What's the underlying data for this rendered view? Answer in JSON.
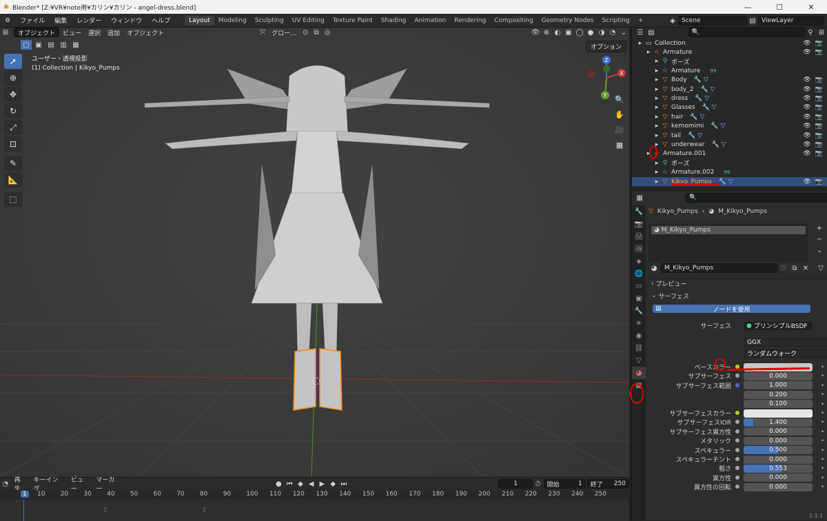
{
  "titlebar": {
    "title": "Blender* [Z:¥VR¥note用¥カリン¥カリン - angel-dress.blend]",
    "minimize": "—",
    "maximize": "☐",
    "close": "✕"
  },
  "menubar": {
    "items": [
      "ファイル",
      "編集",
      "レンダー",
      "ウィンドウ",
      "ヘルプ"
    ],
    "workspaces": [
      "Layout",
      "Modeling",
      "Sculpting",
      "UV Editing",
      "Texture Paint",
      "Shading",
      "Animation",
      "Rendering",
      "Compositing",
      "Geometry Nodes",
      "Scripting"
    ],
    "add_ws": "+",
    "scene": "Scene",
    "view_layer": "ViewLayer"
  },
  "viewport": {
    "mode": "オブジェクト",
    "menus": [
      "ビュー",
      "選択",
      "追加",
      "オブジェクト"
    ],
    "transform": "グロー…",
    "info_line1": "ユーザー・透視投影",
    "info_line2": "(1) Collection | Kikyo_Pumps",
    "option": "オプション",
    "gizmo": {
      "x": "X",
      "y": "Y",
      "z": "Z"
    }
  },
  "timeline": {
    "menus": [
      "再生",
      "キーイング",
      "ビュー",
      "マーカー"
    ],
    "current_frame": "1",
    "start_label": "開始",
    "start": "1",
    "end_label": "終了",
    "end": "250",
    "ticks": [
      "1",
      "10",
      "20",
      "30",
      "40",
      "50",
      "60",
      "70",
      "80",
      "90",
      "100",
      "110",
      "120",
      "130",
      "140",
      "150",
      "160",
      "170",
      "180",
      "190",
      "200",
      "210",
      "220",
      "230",
      "240",
      "250"
    ]
  },
  "outliner": {
    "search_placeholder": "",
    "rows": [
      {
        "label": "Collection",
        "depth": 0,
        "icon": "collection-icon"
      },
      {
        "label": "Armature",
        "depth": 1,
        "icon": "armature-icon"
      },
      {
        "label": "ポーズ",
        "depth": 2,
        "icon": "pose-icon"
      },
      {
        "label": "Armature",
        "depth": 2,
        "icon": "armature-data-icon",
        "badge": "99"
      },
      {
        "label": "Body",
        "depth": 2,
        "icon": "mesh-icon"
      },
      {
        "label": "body_2",
        "depth": 2,
        "icon": "mesh-icon"
      },
      {
        "label": "dress",
        "depth": 2,
        "icon": "mesh-icon"
      },
      {
        "label": "Glasses",
        "depth": 2,
        "icon": "mesh-icon"
      },
      {
        "label": "hair",
        "depth": 2,
        "icon": "mesh-icon"
      },
      {
        "label": "kemomimi",
        "depth": 2,
        "icon": "mesh-icon"
      },
      {
        "label": "tail",
        "depth": 2,
        "icon": "mesh-icon"
      },
      {
        "label": "underwear",
        "depth": 2,
        "icon": "mesh-icon"
      },
      {
        "label": "Armature.001",
        "depth": 1,
        "icon": "armature-icon"
      },
      {
        "label": "ポーズ",
        "depth": 2,
        "icon": "pose-icon"
      },
      {
        "label": "Armature.002",
        "depth": 2,
        "icon": "armature-data-icon",
        "badge": "99"
      },
      {
        "label": "Kikyo_Pumps",
        "depth": 2,
        "icon": "mesh-icon",
        "selected": true
      }
    ]
  },
  "properties": {
    "breadcrumb_object": "Kikyo_Pumps",
    "breadcrumb_material": "M_Kikyo_Pumps",
    "slot": "M_Kikyo_Pumps",
    "material_name": "M_Kikyo_Pumps",
    "preview_label": "プレビュー",
    "surface_label": "サーフェス",
    "use_nodes": "ノードを使用",
    "surface_type_label": "サーフェス",
    "surface_type": "プリンシプルBSDF",
    "distribution": "GGX",
    "subsurface_method": "ランダムウォーク",
    "fields": [
      {
        "label": "ベースカラー",
        "type": "color",
        "color": "#c8c8c8"
      },
      {
        "label": "サブサーフェス",
        "value": "0.000",
        "fill": 0
      },
      {
        "label": "サブサーフェス範囲",
        "value": "1.000",
        "fill": 0
      },
      {
        "label": "",
        "value": "0.200",
        "fill": 0
      },
      {
        "label": "",
        "value": "0.100",
        "fill": 0
      },
      {
        "label": "サブサーフェスカラー",
        "type": "color",
        "color": "#e6e6e6"
      },
      {
        "label": "サブサーフェスIOR",
        "value": "1.400",
        "fill": 0.14
      },
      {
        "label": "サブサーフェス異方性",
        "value": "0.000",
        "fill": 0
      },
      {
        "label": "メタリック",
        "value": "0.000",
        "fill": 0
      },
      {
        "label": "スペキュラー",
        "value": "0.500",
        "fill": 0.5
      },
      {
        "label": "スペキュラーチント",
        "value": "0.000",
        "fill": 0
      },
      {
        "label": "粗さ",
        "value": "0.553",
        "fill": 0.553
      },
      {
        "label": "異方性",
        "value": "0.000",
        "fill": 0
      },
      {
        "label": "異方性の回転",
        "value": "0.000",
        "fill": 0
      }
    ]
  },
  "status": {
    "version": "3.3.1"
  },
  "colors": {
    "accent": "#4772b3",
    "selection": "#334d80",
    "annotation": "#e00000",
    "active_text": "#ffaf29"
  }
}
